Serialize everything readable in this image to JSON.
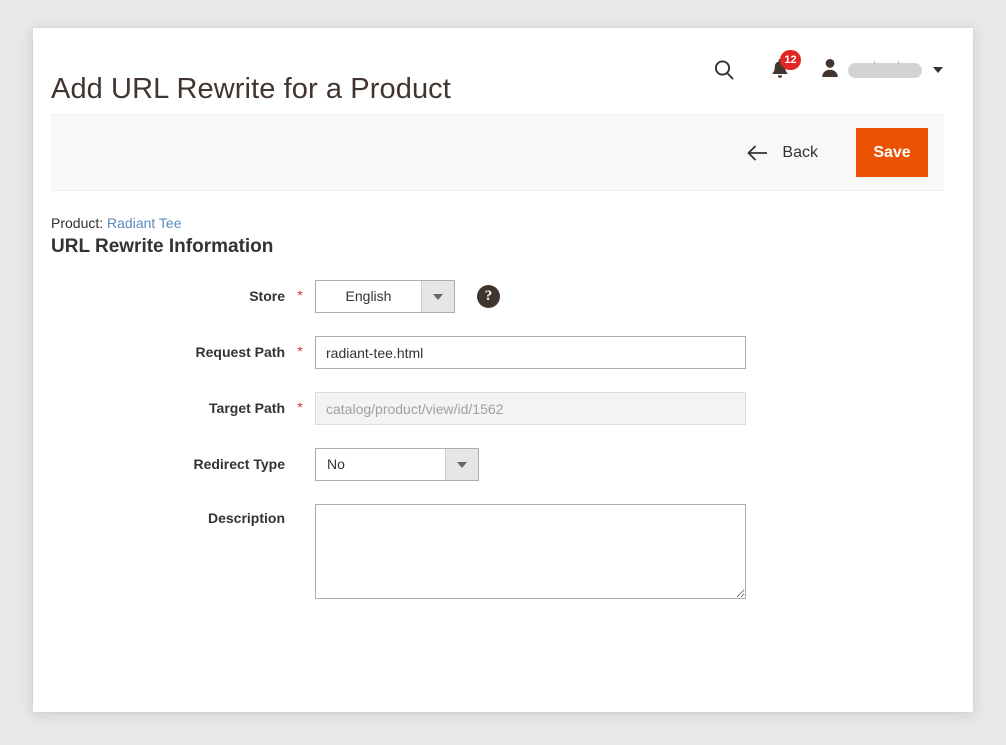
{
  "header": {
    "title": "Add URL Rewrite for a Product",
    "search_icon": "search-icon",
    "notifications_icon": "bell-icon",
    "notifications_count": "12",
    "user_icon": "user-icon",
    "user_name": "",
    "user_caret_icon": "chevron-down-icon"
  },
  "toolbar": {
    "back_label": "Back",
    "back_icon": "arrow-left-icon",
    "save_label": "Save",
    "save_color": "#eb5202"
  },
  "content": {
    "product_prefix": "Product:",
    "product_name": "Radiant Tee",
    "product_link_color": "#5a8bbd",
    "section_title": "URL Rewrite Information"
  },
  "form": {
    "store": {
      "label": "Store",
      "required_mark": "*",
      "value": "English",
      "dropdown_icon": "chevron-down-icon",
      "help_icon": "question-mark-icon",
      "help_label": "?"
    },
    "request_path": {
      "label": "Request Path",
      "required_mark": "*",
      "value": "radiant-tee.html",
      "placeholder": ""
    },
    "target_path": {
      "label": "Target Path",
      "required_mark": "*",
      "value": "catalog/product/view/id/1562",
      "disabled": true
    },
    "redirect_type": {
      "label": "Redirect Type",
      "value": "No",
      "dropdown_icon": "chevron-down-icon"
    },
    "description": {
      "label": "Description",
      "value": "",
      "placeholder": ""
    }
  }
}
